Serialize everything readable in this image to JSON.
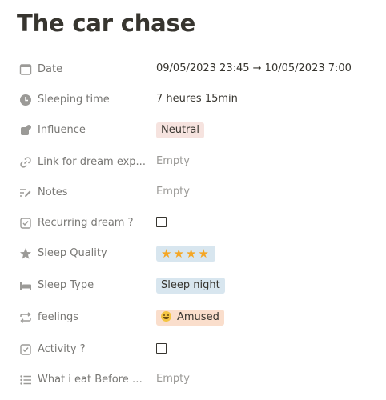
{
  "page": {
    "title": "The car chase"
  },
  "properties": [
    {
      "icon": "calendar-icon",
      "label": "Date",
      "value": "09/05/2023 23:45 → 10/05/2023 7:00"
    },
    {
      "icon": "clock-icon",
      "label": "Sleeping time",
      "value": "7 heures 15min"
    },
    {
      "icon": "shapes-icon",
      "label": "Influence",
      "value": "Neutral"
    },
    {
      "icon": "link-icon",
      "label": "Link for dream exp...",
      "value": "Empty"
    },
    {
      "icon": "text-edit-icon",
      "label": "Notes",
      "value": "Empty"
    },
    {
      "icon": "checkbox-icon",
      "label": "Recurring dream ?",
      "checked": false
    },
    {
      "icon": "star-icon",
      "label": "Sleep Quality",
      "value": "★★★★",
      "rating": 4
    },
    {
      "icon": "bed-icon",
      "label": "Sleep Type",
      "value": "Sleep night"
    },
    {
      "icon": "repeat-icon",
      "label": "feelings",
      "value": "Amused",
      "emoji": "grinning-face-icon"
    },
    {
      "icon": "checkbox-icon",
      "label": "Activity ?",
      "checked": false
    },
    {
      "icon": "list-icon",
      "label": "What i eat Before s...",
      "value": "Empty"
    }
  ],
  "colors": {
    "label": "#787774",
    "text": "#37352f",
    "empty": "#9b9a97",
    "tag_neutral": "#f6e3df",
    "tag_blue": "#d8e6ef",
    "tag_orange": "#fadecc",
    "star": "#f5a623"
  }
}
